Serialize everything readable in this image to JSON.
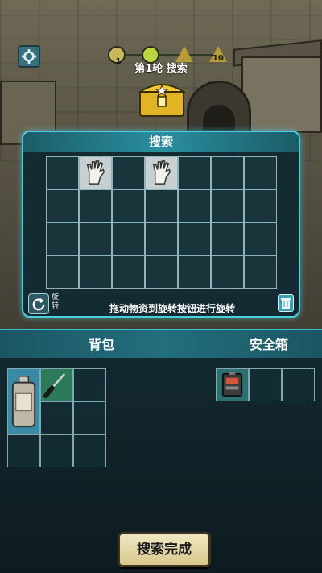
{
  "hud": {
    "round_title": "第1轮 搜索",
    "round_nodes": [
      "1",
      "",
      "",
      "10"
    ]
  },
  "search_panel": {
    "title": "搜索",
    "rotate_label": "旋转",
    "hint": "拖动物资到旋转按钮进行旋转",
    "grid": {
      "cols": 7,
      "rows": 4,
      "items": [
        "glove",
        "glove"
      ]
    }
  },
  "inventory": {
    "bag_title": "背包",
    "safe_title": "安全箱",
    "bag_items": [
      "flask",
      "screwdriver"
    ],
    "safe_items": [
      "battery-box"
    ]
  },
  "done_button": "搜索完成",
  "colors": {
    "accent": "#4ad0e0",
    "panel": "#132a32",
    "button": "#e6dba8"
  }
}
